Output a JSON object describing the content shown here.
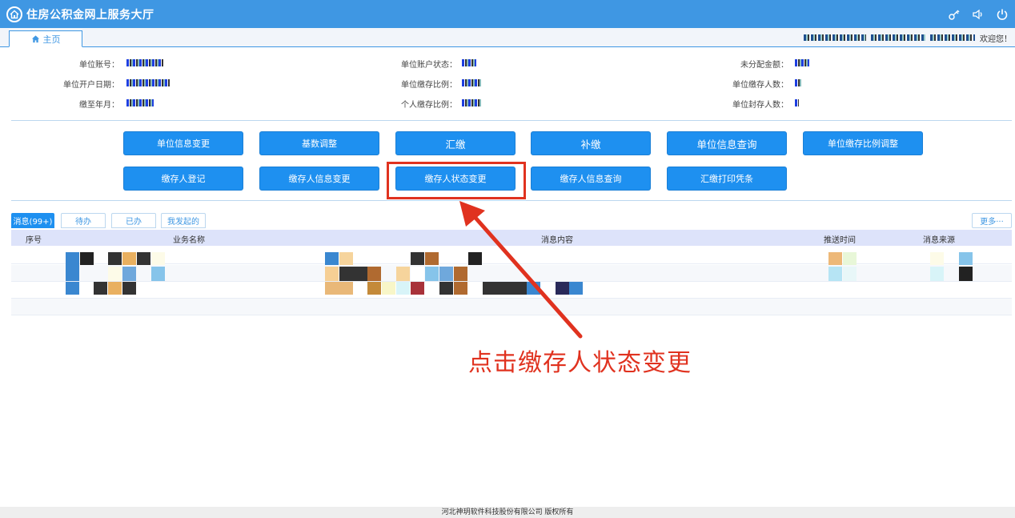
{
  "header": {
    "title": "住房公积金网上服务大厅",
    "icons": [
      "key-icon",
      "speaker-icon",
      "power-icon"
    ]
  },
  "tabbar": {
    "home_tab": "主页",
    "welcome": "欢迎您！"
  },
  "info": {
    "unit_account_label": "单位账号：",
    "unit_open_date_label": "单位开户日期：",
    "paid_until_label": "缴至年月：",
    "unit_account_status_label": "单位账户状态：",
    "unit_ratio_label": "单位缴存比例：",
    "personal_ratio_label": "个人缴存比例：",
    "unallocated_label": "未分配金额：",
    "unit_depositors_label": "单位缴存人数：",
    "unit_sealed_label": "单位封存人数："
  },
  "buttons": {
    "row1": [
      "单位信息变更",
      "基数调整",
      "汇缴",
      "补缴",
      "单位信息查询",
      "单位缴存比例调整"
    ],
    "row2": [
      "缴存人登记",
      "缴存人信息变更",
      "缴存人状态变更",
      "缴存人信息查询",
      "汇缴打印凭条"
    ]
  },
  "messages": {
    "tabs": [
      "消息(99+)",
      "待办",
      "已办",
      "我发起的"
    ],
    "more": "更多···",
    "columns": [
      "序号",
      "业务名称",
      "消息内容",
      "推送时间",
      "消息来源"
    ]
  },
  "annotation": {
    "text": "点击缴存人状态变更"
  },
  "footer": {
    "text": "河北神玥软件科技股份有限公司 版权所有"
  },
  "colors": {
    "primary": "#3f97e3",
    "button": "#1e90f0",
    "annotation": "#e0321f",
    "table_header": "#dde3fa"
  }
}
